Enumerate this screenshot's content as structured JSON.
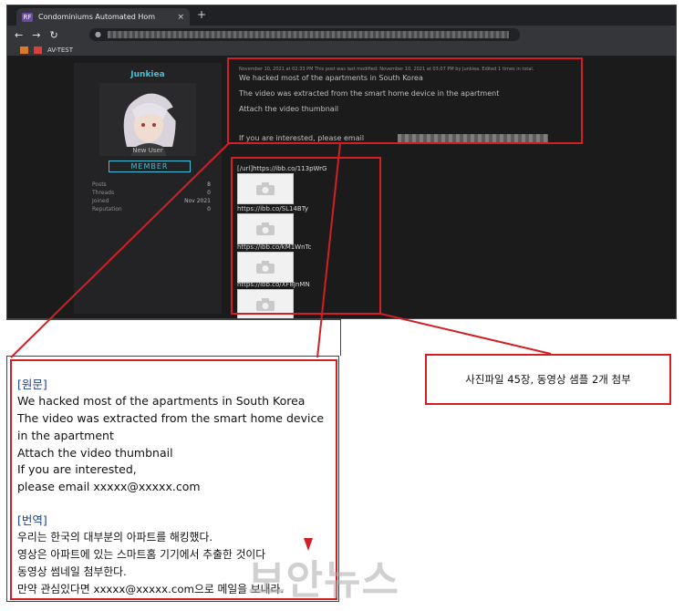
{
  "browser": {
    "tab_title": "Condominiums Automated Hom",
    "tab_favicon": "RF",
    "tab_close": "×",
    "new_tab": "+",
    "bookmark_label": "AV-TEST"
  },
  "profile": {
    "username": "Junkiea",
    "user_title": "New User",
    "rank": "MEMBER",
    "stats": [
      {
        "label": "Posts",
        "value": "8"
      },
      {
        "label": "Threads",
        "value": "0"
      },
      {
        "label": "Joined",
        "value": "Nov 2021"
      },
      {
        "label": "Reputation",
        "value": "0"
      }
    ]
  },
  "post": {
    "meta": "November 10, 2021 at 02:33 PM   This post was last modified: November 10, 2021 at 03:07 PM by Junkiea. Edited 1 times in total.",
    "lines": [
      "We hacked most of the apartments in South Korea",
      "The video was extracted from the smart home device in the apartment",
      "Attach the video thumbnail",
      "If you are interested, please email"
    ],
    "links": [
      "[/url]https://ibb.co/113pWrG",
      "https://ibb.co/SL14BTy",
      "https://ibb.co/kM1WnTc",
      "https://ibb.co/XF8JnMN"
    ]
  },
  "caption": "사진파일 45장, 동영상 샘플 2개 첨부",
  "translation": {
    "original_header": "[원문]",
    "original_lines": [
      "We hacked most of the apartments in South Korea",
      "The video was extracted from the smart home device",
      "in the apartment",
      "Attach the video thumbnail",
      "If you are interested,",
      "please email xxxxx@xxxxx.com"
    ],
    "translated_header": "[번역]",
    "translated_lines": [
      "우리는 한국의 대부분의 아파트를 해킹했다.",
      "영상은 아파트에 있는 스마트홈 기기에서 추출한 것이다",
      "동영상 썸네일 첨부한다.",
      "만약 관심있다면 xxxxx@xxxxx.com으로 메일을 보내라."
    ]
  },
  "watermark": "보안뉴스",
  "colors": {
    "highlight": "#d11f24",
    "accent": "#41c0d9",
    "header": "#1b3e8c"
  }
}
